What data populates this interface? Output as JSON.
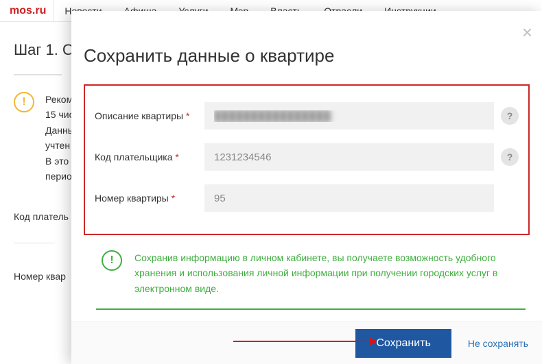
{
  "topnav": {
    "logo": "mos.ru",
    "items": [
      "Новости",
      "Афиша",
      "Услуги",
      "Мэр",
      "Власть",
      "Отрасли",
      "Инструкции"
    ]
  },
  "step": {
    "title": "Шаг 1. О"
  },
  "bg_notice": {
    "lines": [
      "Реком",
      "15 чис",
      "Данны",
      "учтен",
      "В это",
      "перио"
    ]
  },
  "bg_labels": {
    "payer": "Код платель",
    "apt": "Номер квар"
  },
  "modal": {
    "title": "Сохранить данные о квартире",
    "fields": {
      "desc": {
        "label": "Описание квартиры",
        "value": "████████████████"
      },
      "payer": {
        "label": "Код плательщика",
        "value": "1231234546"
      },
      "apt": {
        "label": "Номер квартиры",
        "value": "95"
      }
    },
    "info": "Сохранив информацию в личном кабинете, вы получаете возможность удобного хранения и использования личной информации при получении городских услуг в электронном виде.",
    "save": "Сохранить",
    "cancel": "Не сохранять",
    "help": "?",
    "exclaim": "!"
  }
}
